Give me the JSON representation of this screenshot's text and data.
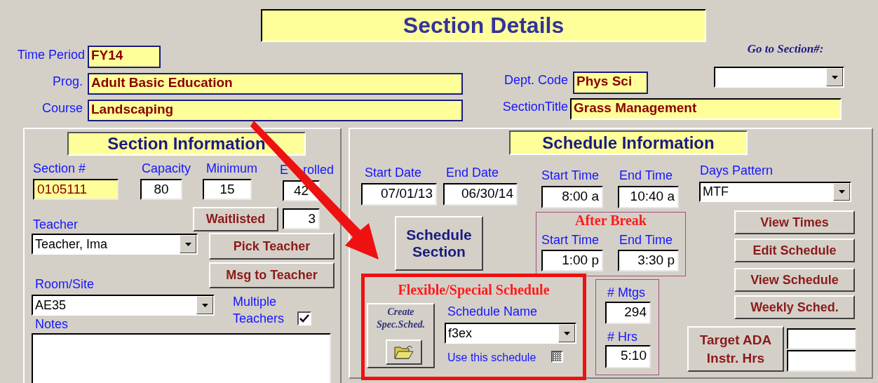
{
  "title": "Section Details",
  "header_fields": [
    {
      "label": "Time Period",
      "value": "FY14"
    },
    {
      "label": "Prog.",
      "value": "Adult Basic Education"
    },
    {
      "label": "Course",
      "value": "Landscaping"
    },
    {
      "label": "Dept. Code",
      "value": "Phys Sci"
    },
    {
      "label": "SectionTitle",
      "value": "Grass Management"
    }
  ],
  "goto_section": {
    "label": "Go to Section#:"
  },
  "section_info": {
    "title": "Section Information",
    "fields": [
      {
        "label": "Section #",
        "value": "0105111",
        "kind": "key"
      },
      {
        "label": "Capacity",
        "value": "80",
        "kind": "number"
      },
      {
        "label": "Minimum",
        "value": "15",
        "kind": "number"
      },
      {
        "label": "E",
        "label_2": "rolled",
        "value": "42",
        "kind": "number"
      }
    ],
    "waitlisted": {
      "button": "Waitlisted",
      "value": "3"
    },
    "teacher": {
      "label": "Teacher",
      "value": "Teacher, Ima"
    },
    "buttons": [
      "Pick Teacher",
      "Msg to Teacher"
    ],
    "room": {
      "label": "Room/Site",
      "value": "AE35"
    },
    "multiple_teachers": {
      "label": "Multiple",
      "label_2": "Teachers",
      "checked": true
    },
    "notes": {
      "label": "Notes"
    }
  },
  "schedule_info": {
    "title": "Schedule Information",
    "fields": [
      {
        "label": "Start Date",
        "value": "07/01/13"
      },
      {
        "label": "End Date",
        "value": "06/30/14"
      },
      {
        "label": "Start Time",
        "value": "8:00 a"
      },
      {
        "label": "End Time",
        "value": "10:40 a"
      }
    ],
    "days_pattern": {
      "label": "Days Pattern",
      "value": "MTF"
    },
    "schedule_button": "Schedule Section",
    "after_break": {
      "title": "After Break",
      "fields": [
        {
          "label": "Start Time",
          "value": "1:00 p"
        },
        {
          "label": "End Time",
          "value": "3:30 p"
        }
      ]
    },
    "buttons": [
      "View Times",
      "Edit Schedule",
      "View Schedule",
      "Weekly Sched."
    ],
    "flexible": {
      "title": "Flexible/Special Schedule",
      "create_label": "Create Spec.Sched.",
      "schedule_name": {
        "label": "Schedule Name",
        "value": "f3ex"
      },
      "use_schedule": {
        "label": "Use this schedule",
        "disabled": true
      }
    },
    "counts": [
      {
        "label": "# Mtgs",
        "value": "294"
      },
      {
        "label": "# Hrs",
        "value": "5:10"
      }
    ],
    "target_button": "Target ADA Instr. Hrs"
  }
}
